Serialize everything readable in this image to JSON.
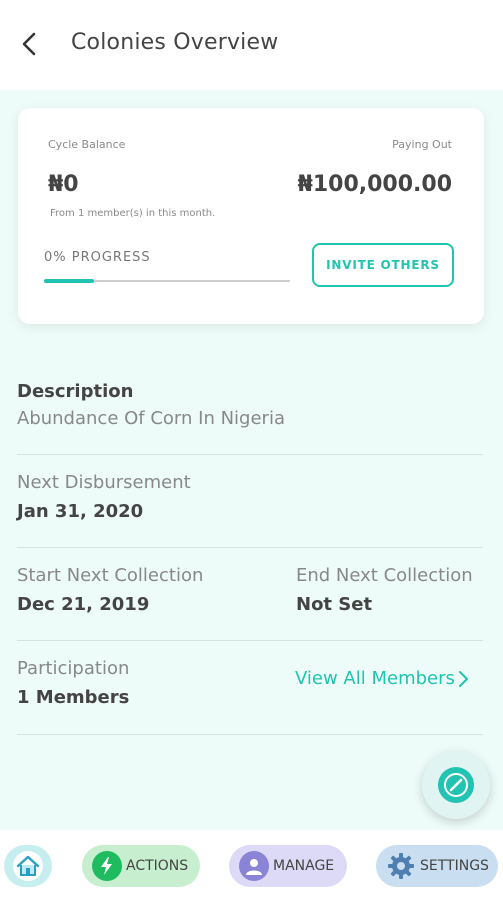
{
  "header": {
    "back_icon": "chevron-left-icon",
    "title": "Colonies Overview"
  },
  "card": {
    "cycle_balance_label": "Cycle Balance",
    "cycle_balance_amount": "₦0",
    "paying_out_label": "Paying Out",
    "paying_out_amount": "₦100,000.00",
    "members_note": "From 1 member(s) in this month.",
    "progress_label": "0% PROGRESS",
    "progress_value": 0,
    "invite_button": "INVITE OTHERS"
  },
  "details": {
    "description_title": "Description",
    "description_text": "Abundance Of Corn In Nigeria",
    "next_disbursement_label": "Next Disbursement",
    "next_disbursement_value": "Jan 31, 2020",
    "start_collection_label": "Start Next Collection",
    "start_collection_value": "Dec 21, 2019",
    "end_collection_label": "End Next Collection",
    "end_collection_value": "Not Set",
    "participation_label": "Participation",
    "participation_value": "1 Members",
    "view_all_link": "View All Members"
  },
  "bottom_nav": {
    "home_icon": "home-icon",
    "actions_label": "ACTIONS",
    "manage_label": "MANAGE",
    "settings_label": "SETTINGS"
  },
  "colors": {
    "accent": "#20c4b0",
    "background": "#eefcf9"
  }
}
